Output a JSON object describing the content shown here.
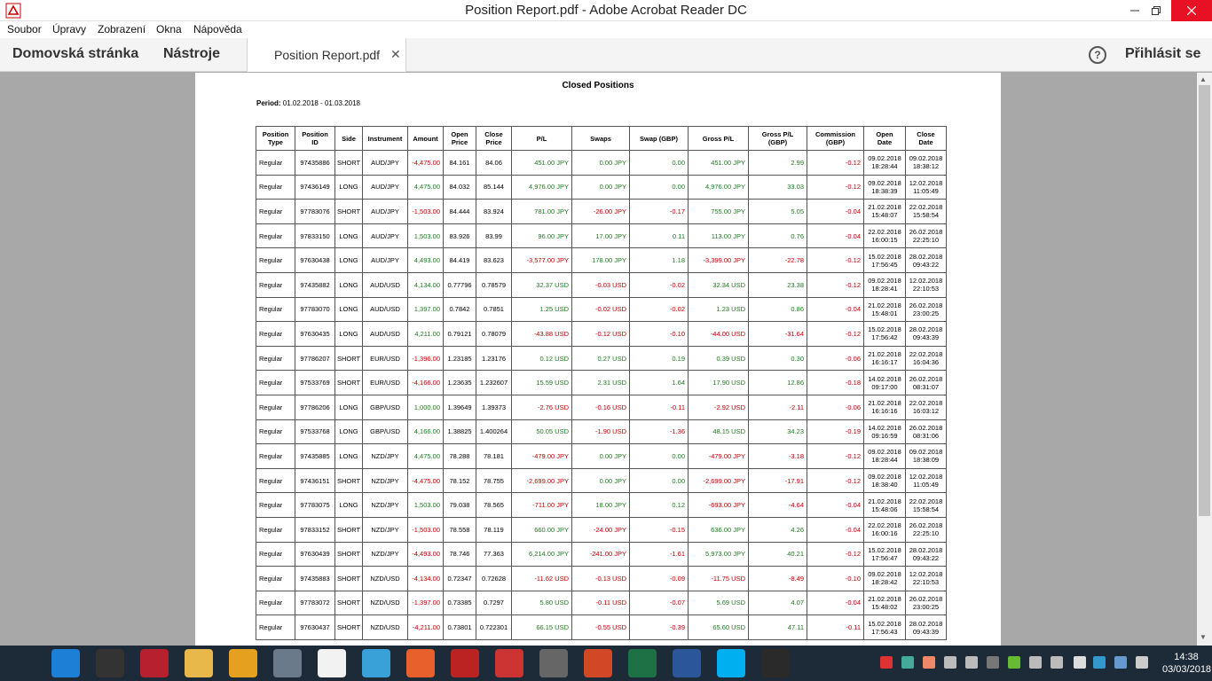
{
  "window": {
    "title": "Position Report.pdf - Adobe Acrobat Reader DC"
  },
  "menu": [
    "Soubor",
    "Úpravy",
    "Zobrazení",
    "Okna",
    "Nápověda"
  ],
  "toolbar": {
    "home": "Domovská stránka",
    "tools": "Nástroje",
    "tab": "Position Report.pdf",
    "help_glyph": "?",
    "sign_in": "Přihlásit se"
  },
  "report": {
    "title": "Closed Positions",
    "period_label": "Period:",
    "period_value": "01.02.2018 - 01.03.2018",
    "columns": [
      [
        "Position",
        "Type"
      ],
      [
        "Position",
        "ID"
      ],
      [
        "Side",
        ""
      ],
      [
        "Instrument",
        ""
      ],
      [
        "Amount",
        ""
      ],
      [
        "Open",
        "Price"
      ],
      [
        "Close",
        "Price"
      ],
      [
        "P/L",
        ""
      ],
      [
        "Swaps",
        ""
      ],
      [
        "Swap (GBP)",
        ""
      ],
      [
        "Gross P/L",
        ""
      ],
      [
        "Gross P/L",
        "(GBP)"
      ],
      [
        "Commission",
        "(GBP)"
      ],
      [
        "Open",
        "Date"
      ],
      [
        "Close",
        "Date"
      ]
    ],
    "rows": [
      [
        "Regular",
        "97435886",
        "SHORT",
        "AUD/JPY",
        "-4,475.00",
        "84.161",
        "84.06",
        "451.00 JPY",
        "0.00 JPY",
        "0.00",
        "451.00 JPY",
        "2.99",
        "-0.12",
        "09.02.2018",
        "18:28:44",
        "09.02.2018",
        "18:38:12"
      ],
      [
        "Regular",
        "97436149",
        "LONG",
        "AUD/JPY",
        "4,475.00",
        "84.032",
        "85.144",
        "4,976.00 JPY",
        "0.00 JPY",
        "0.00",
        "4,976.00 JPY",
        "33.03",
        "-0.12",
        "09.02.2018",
        "18:38:39",
        "12.02.2018",
        "11:05:49"
      ],
      [
        "Regular",
        "97783076",
        "SHORT",
        "AUD/JPY",
        "-1,503.00",
        "84.444",
        "83.924",
        "781.00 JPY",
        "-26.00 JPY",
        "-0.17",
        "755.00 JPY",
        "5.05",
        "-0.04",
        "21.02.2018",
        "15:48:07",
        "22.02.2018",
        "15:58:54"
      ],
      [
        "Regular",
        "97833150",
        "LONG",
        "AUD/JPY",
        "1,503.00",
        "83.926",
        "83.99",
        "96.00 JPY",
        "17.00 JPY",
        "0.11",
        "113.00 JPY",
        "0.76",
        "-0.04",
        "22.02.2018",
        "16:00:15",
        "26.02.2018",
        "22:25:10"
      ],
      [
        "Regular",
        "97630438",
        "LONG",
        "AUD/JPY",
        "4,493.00",
        "84.419",
        "83.623",
        "-3,577.00 JPY",
        "178.00 JPY",
        "1.18",
        "-3,399.00 JPY",
        "-22.78",
        "-0.12",
        "15.02.2018",
        "17:56:45",
        "28.02.2018",
        "09:43:22"
      ],
      [
        "Regular",
        "97435882",
        "LONG",
        "AUD/USD",
        "4,134.00",
        "0.77796",
        "0.78579",
        "32.37 USD",
        "-0.03 USD",
        "-0.02",
        "32.34 USD",
        "23.38",
        "-0.12",
        "09.02.2018",
        "18:28:41",
        "12.02.2018",
        "22:10:53"
      ],
      [
        "Regular",
        "97783070",
        "LONG",
        "AUD/USD",
        "1,397.00",
        "0.7842",
        "0.7851",
        "1.25 USD",
        "-0.02 USD",
        "-0.02",
        "1.23 USD",
        "0.86",
        "-0.04",
        "21.02.2018",
        "15:48:01",
        "26.02.2018",
        "23:00:25"
      ],
      [
        "Regular",
        "97630435",
        "LONG",
        "AUD/USD",
        "4,211.00",
        "0.79121",
        "0.78079",
        "-43.88 USD",
        "-0.12 USD",
        "-0.10",
        "-44.00 USD",
        "-31.64",
        "-0.12",
        "15.02.2018",
        "17:56:42",
        "28.02.2018",
        "09:43:39"
      ],
      [
        "Regular",
        "97786207",
        "SHORT",
        "EUR/USD",
        "-1,396.00",
        "1.23185",
        "1.23176",
        "0.12 USD",
        "0.27 USD",
        "0.19",
        "0.39 USD",
        "0.30",
        "-0.06",
        "21.02.2018",
        "16:16:17",
        "22.02.2018",
        "16:04:36"
      ],
      [
        "Regular",
        "97533769",
        "SHORT",
        "EUR/USD",
        "-4,166.00",
        "1.23635",
        "1.232607",
        "15.59 USD",
        "2.31 USD",
        "1.64",
        "17.90 USD",
        "12.86",
        "-0.18",
        "14.02.2018",
        "09:17:00",
        "26.02.2018",
        "08:31:07"
      ],
      [
        "Regular",
        "97786206",
        "LONG",
        "GBP/USD",
        "1,000.00",
        "1.39649",
        "1.39373",
        "-2.76 USD",
        "-0.16 USD",
        "-0.11",
        "-2.92 USD",
        "-2.11",
        "-0.06",
        "21.02.2018",
        "16:16:16",
        "22.02.2018",
        "16:03:12"
      ],
      [
        "Regular",
        "97533768",
        "LONG",
        "GBP/USD",
        "4,166.00",
        "1.38825",
        "1.400264",
        "50.05 USD",
        "-1.90 USD",
        "-1.36",
        "48.15 USD",
        "34.23",
        "-0.19",
        "14.02.2018",
        "09:16:59",
        "26.02.2018",
        "08:31:06"
      ],
      [
        "Regular",
        "97435885",
        "LONG",
        "NZD/JPY",
        "4,475.00",
        "78.288",
        "78.181",
        "-479.00 JPY",
        "0.00 JPY",
        "0.00",
        "-479.00 JPY",
        "-3.18",
        "-0.12",
        "09.02.2018",
        "18:28:44",
        "09.02.2018",
        "18:38:09"
      ],
      [
        "Regular",
        "97436151",
        "SHORT",
        "NZD/JPY",
        "-4,475.00",
        "78.152",
        "78.755",
        "-2,699.00 JPY",
        "0.00 JPY",
        "0.00",
        "-2,699.00 JPY",
        "-17.91",
        "-0.12",
        "09.02.2018",
        "18:38:40",
        "12.02.2018",
        "11:05:49"
      ],
      [
        "Regular",
        "97783075",
        "LONG",
        "NZD/JPY",
        "1,503.00",
        "79.038",
        "78.565",
        "-711.00 JPY",
        "18.00 JPY",
        "0.12",
        "-693.00 JPY",
        "-4.64",
        "-0.04",
        "21.02.2018",
        "15:48:06",
        "22.02.2018",
        "15:58:54"
      ],
      [
        "Regular",
        "97833152",
        "SHORT",
        "NZD/JPY",
        "-1,503.00",
        "78.558",
        "78.119",
        "660.00 JPY",
        "-24.00 JPY",
        "-0.15",
        "636.00 JPY",
        "4.26",
        "-0.04",
        "22.02.2018",
        "16:00:16",
        "26.02.2018",
        "22:25:10"
      ],
      [
        "Regular",
        "97630439",
        "SHORT",
        "NZD/JPY",
        "-4,493.00",
        "78.746",
        "77.363",
        "6,214.00 JPY",
        "-241.00 JPY",
        "-1.61",
        "5,973.00 JPY",
        "40.21",
        "-0.12",
        "15.02.2018",
        "17:56:47",
        "28.02.2018",
        "09:43:22"
      ],
      [
        "Regular",
        "97435883",
        "SHORT",
        "NZD/USD",
        "-4,134.00",
        "0.72347",
        "0.72628",
        "-11.62 USD",
        "-0.13 USD",
        "-0.09",
        "-11.75 USD",
        "-8.49",
        "-0.10",
        "09.02.2018",
        "18:28:42",
        "12.02.2018",
        "22:10:53"
      ],
      [
        "Regular",
        "97783072",
        "SHORT",
        "NZD/USD",
        "-1,397.00",
        "0.73385",
        "0.7297",
        "5.80 USD",
        "-0.11 USD",
        "-0.07",
        "5.69 USD",
        "4.07",
        "-0.04",
        "21.02.2018",
        "15:48:02",
        "26.02.2018",
        "23:00:25"
      ],
      [
        "Regular",
        "97630437",
        "SHORT",
        "NZD/USD",
        "-4,211.00",
        "0.73801",
        "0.722301",
        "66.15 USD",
        "-0.55 USD",
        "-0.39",
        "65.60 USD",
        "47.11",
        "-0.11",
        "15.02.2018",
        "17:56:43",
        "28.02.2018",
        "09:43:39"
      ]
    ]
  },
  "colors": {
    "negative": "#c00000",
    "positive": "#1e7b1e",
    "close": "#e81123",
    "taskbar": "#1d2a38"
  },
  "taskbar": {
    "icons": [
      "start-windows-icon",
      "internet-explorer-icon",
      "xtrade-icon",
      "trading-app-icon",
      "file-explorer-icon",
      "sirius-icon",
      "calculator-icon",
      "notepad-icon",
      "paint-icon",
      "firefox-icon",
      "media-icon",
      "gear-tool-icon",
      "gimp-icon",
      "powerpoint-icon",
      "excel-icon",
      "word-icon",
      "skype-icon",
      "acrobat-icon"
    ],
    "clock_time": "14:38",
    "clock_date": "03/03/2018"
  }
}
